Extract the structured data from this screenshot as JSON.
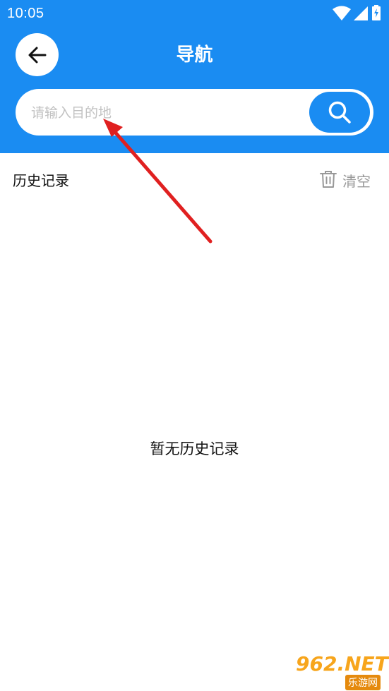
{
  "status_bar": {
    "time": "10:05",
    "icons": [
      "wifi-icon",
      "signal-icon",
      "battery-charging-icon"
    ]
  },
  "header": {
    "title": "导航",
    "back_icon": "arrow-left-icon"
  },
  "search": {
    "placeholder": "请输入目的地",
    "value": "",
    "button_icon": "search-icon"
  },
  "history": {
    "title": "历史记录",
    "clear_label": "清空",
    "clear_icon": "trash-icon",
    "empty_text": "暂无历史记录",
    "items": []
  },
  "watermark": {
    "main": "962.NET",
    "sub": "乐游网"
  },
  "colors": {
    "primary": "#1a8cf2",
    "background": "#ffffff",
    "arrow": "#e02020",
    "watermark": "#f7a51c"
  }
}
